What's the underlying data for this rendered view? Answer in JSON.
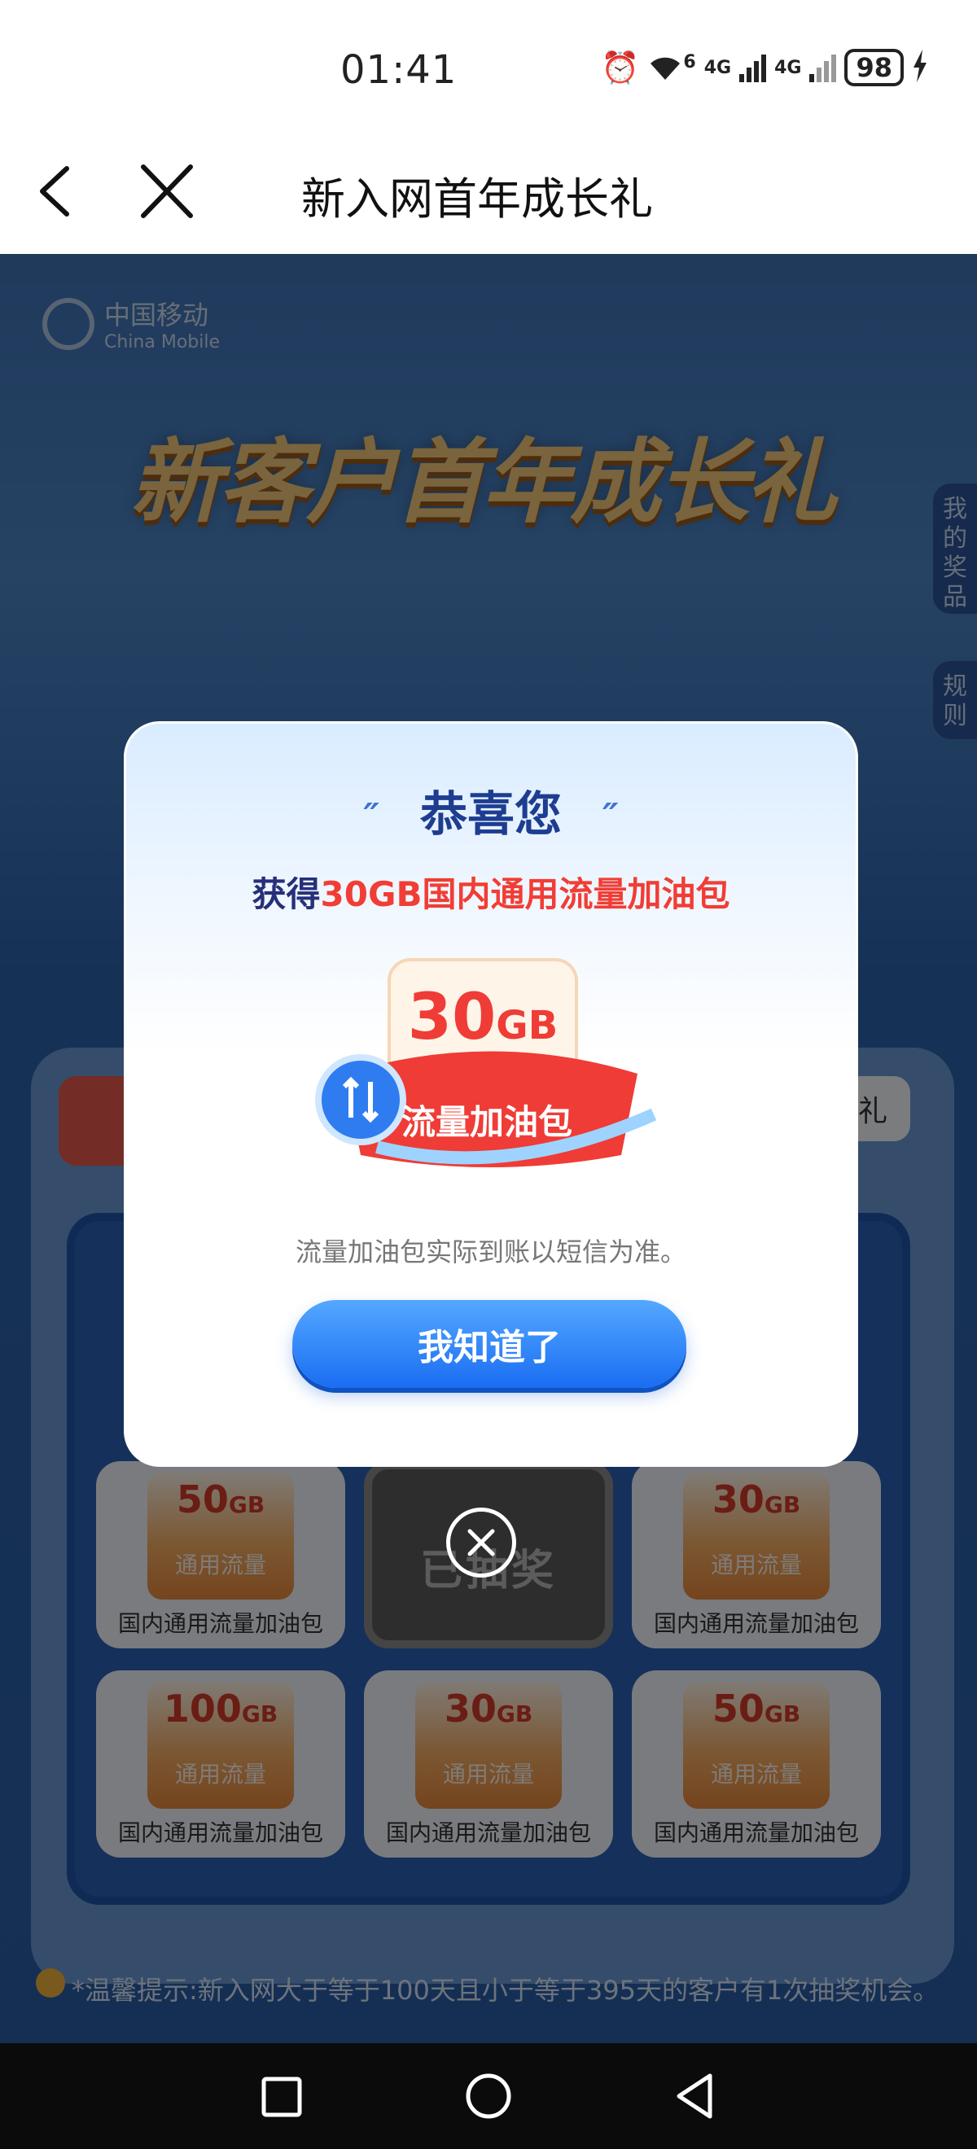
{
  "status_bar": {
    "time": "01:41",
    "battery": "98",
    "net1": "4G",
    "net2": "4G",
    "wifi_sup": "6"
  },
  "titlebar": {
    "title": "新入网首年成长礼"
  },
  "page": {
    "brand_cn": "中国移动",
    "brand_en": "China Mobile",
    "hero": "新客户首年成长礼",
    "side_tab_prizes": "我的奖品",
    "side_tab_rules": "规则",
    "tab_partial": "礼",
    "grid": [
      {
        "amount": "50",
        "unit": "GB",
        "sub": "通用流量",
        "label": "国内通用流量加油包"
      },
      {
        "center": "已抽奖"
      },
      {
        "amount": "30",
        "unit": "GB",
        "sub": "通用流量",
        "label": "国内通用流量加油包"
      },
      {
        "amount": "100",
        "unit": "GB",
        "sub": "通用流量",
        "label": "国内通用流量加油包"
      },
      {
        "amount": "30",
        "unit": "GB",
        "sub": "通用流量",
        "label": "国内通用流量加油包"
      },
      {
        "amount": "50",
        "unit": "GB",
        "sub": "通用流量",
        "label": "国内通用流量加油包"
      }
    ],
    "tip": "*温馨提示:新入网大于等于100天且小于等于395天的客户有1次抽奖机会。"
  },
  "dialog": {
    "heading": "恭喜您",
    "msg_prefix": "获得",
    "msg_highlight": "30GB国内通用流量加油包",
    "art_amount": "30",
    "art_unit": "GB",
    "art_label": "流量加油包",
    "note": "流量加油包实际到账以短信为准。",
    "ok_button": "我知道了"
  },
  "colors": {
    "accent": "#1a6df2",
    "highlight": "#f13d35",
    "heading": "#1e3d91"
  }
}
